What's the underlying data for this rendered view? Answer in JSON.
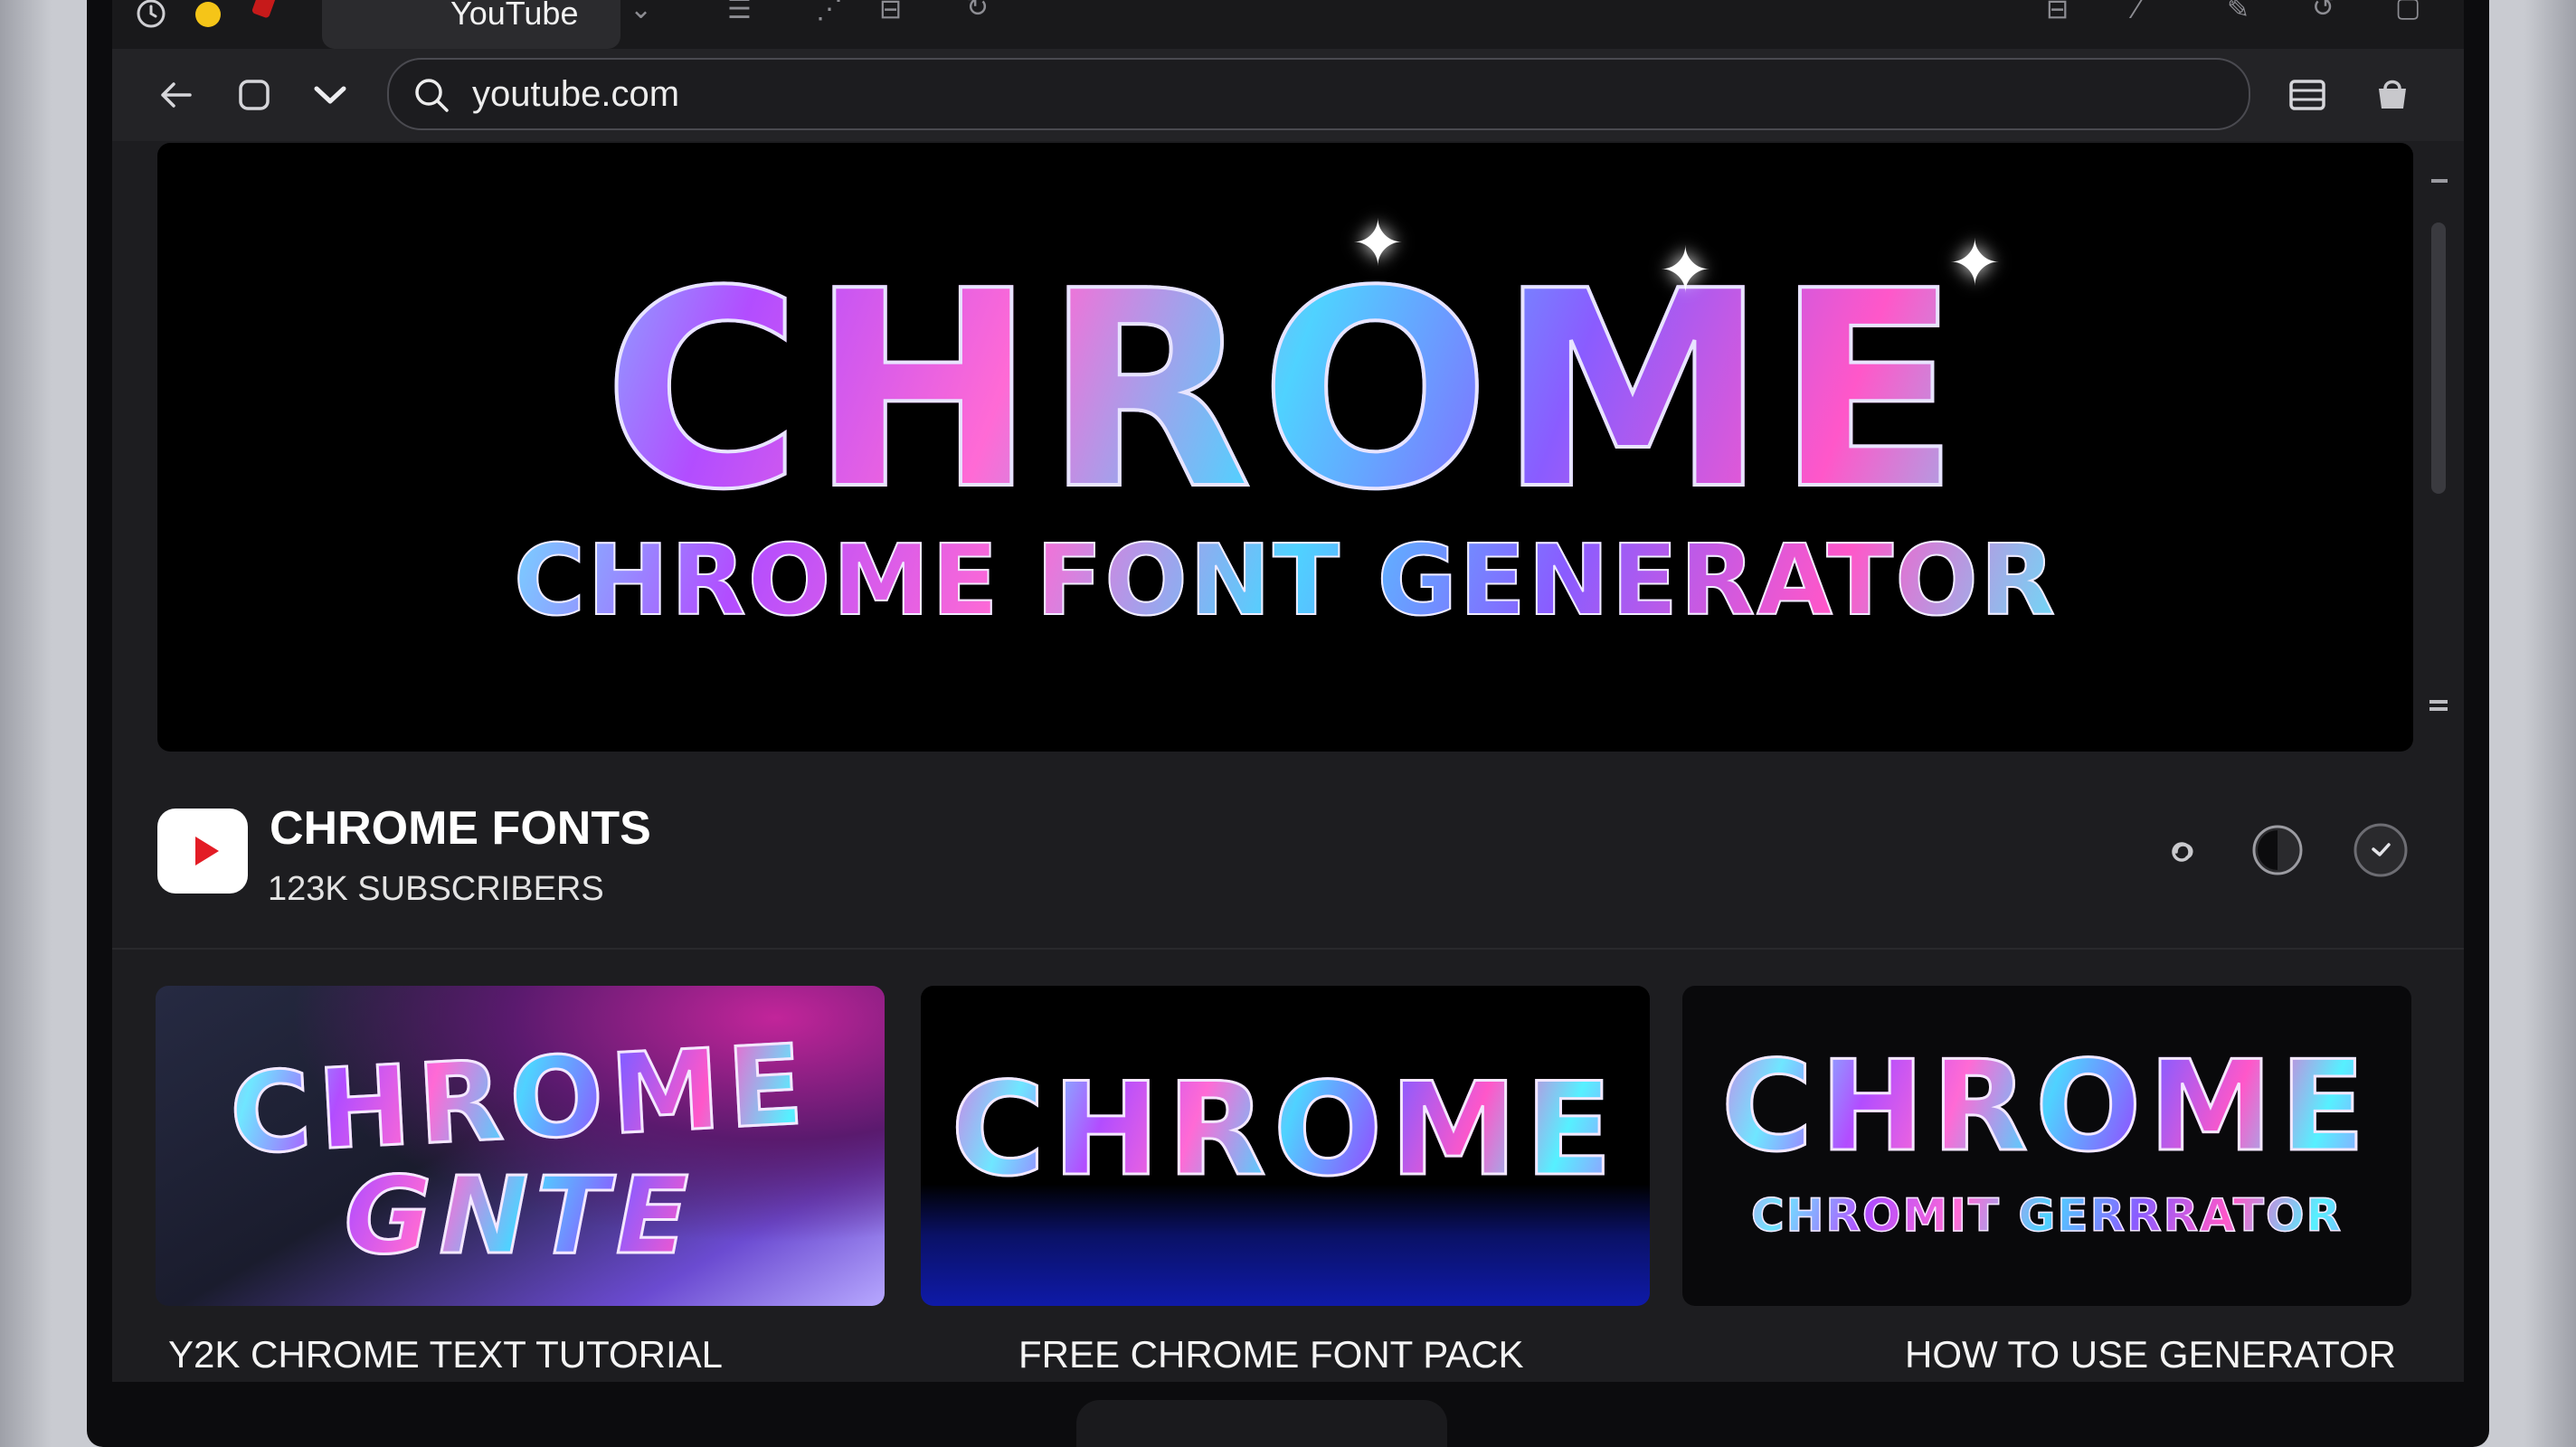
{
  "browser": {
    "tab_title": "YouTube",
    "url": "youtube.com"
  },
  "banner": {
    "title": "CHROME",
    "subtitle": "CHROME FONT GENERATOR"
  },
  "channel": {
    "name": "CHROME FONTS",
    "subscribers": "123K SUBSCRIBERS"
  },
  "videos": [
    {
      "title": "Y2K CHROME TEXT TUTORIAL",
      "thumb_line1": "CHROME",
      "thumb_line2": "GNTE"
    },
    {
      "title": "FREE CHROME FONT PACK",
      "thumb_line1": "CHROME"
    },
    {
      "title": "HOW TO USE GENERATOR",
      "thumb_line1": "CHROME",
      "thumb_line2": "CHROMIT GERRRATOR"
    }
  ],
  "colors": {
    "accent_red": "#e31c25",
    "traffic_yellow": "#f5c518",
    "background": "#1d1d20"
  }
}
